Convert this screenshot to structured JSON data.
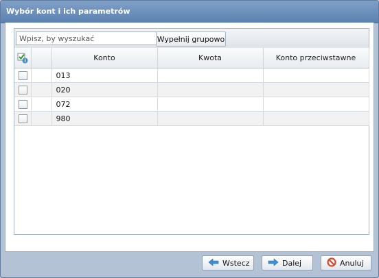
{
  "dialog": {
    "title": "Wybór kont i ich parametrów",
    "search_placeholder": "Wpisz, by wyszukać",
    "fill_group_label": "Wypełnij grupowo"
  },
  "table": {
    "columns": [
      "",
      "",
      "Konto",
      "Kwota",
      "Konto przeciwstawne"
    ],
    "rows": [
      {
        "checked": false,
        "konto": "013",
        "kwota": "",
        "konto_przeciwstawne": ""
      },
      {
        "checked": false,
        "konto": "020",
        "kwota": "",
        "konto_przeciwstawne": ""
      },
      {
        "checked": false,
        "konto": "072",
        "kwota": "",
        "konto_przeciwstawne": ""
      },
      {
        "checked": false,
        "konto": "980",
        "kwota": "",
        "konto_przeciwstawne": ""
      }
    ]
  },
  "footer": {
    "back_label": "Wstecz",
    "next_label": "Dalej",
    "cancel_label": "Anuluj"
  },
  "icons": {
    "header_check": "check-all-info-icon",
    "back": "arrow-left-icon",
    "next": "arrow-right-icon",
    "cancel": "cancel-icon"
  },
  "colors": {
    "titlebar": "#6b8fbb",
    "arrow": "#3a8fd6",
    "cancel": "#d94a2a"
  }
}
